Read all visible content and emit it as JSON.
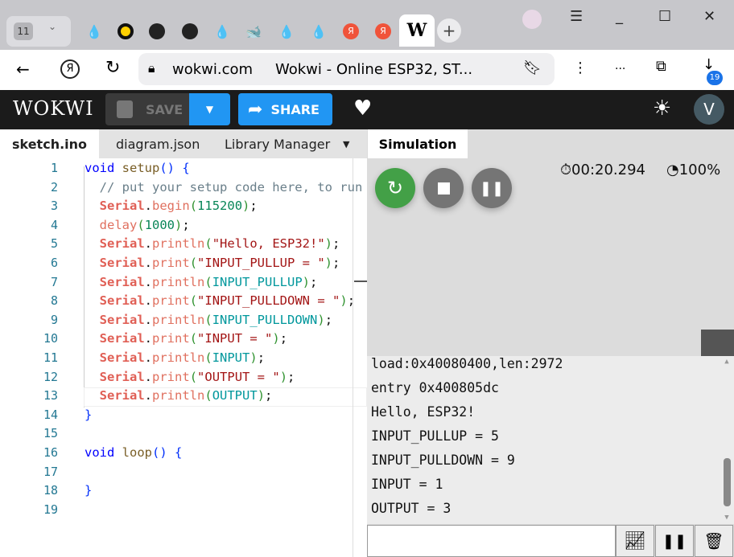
{
  "browser": {
    "tab_count": "11",
    "url": "wokwi.com",
    "page_title": "Wokwi - Online ESP32, ST...",
    "downloads_badge": "19",
    "menu_ellipsis": "..."
  },
  "toolbar": {
    "logo": "WOKWI",
    "save_label": "SAVE",
    "share_label": "SHARE",
    "avatar_letter": "V",
    "accent": "#2196f3"
  },
  "editor_tabs": [
    {
      "label": "sketch.ino",
      "active": true
    },
    {
      "label": "diagram.json"
    },
    {
      "label": "Library Manager"
    }
  ],
  "simulation": {
    "tab_label": "Simulation",
    "timer": "00:20.294",
    "speed": "100%"
  },
  "code": [
    [
      [
        "kw",
        "void"
      ],
      [
        "pu",
        " "
      ],
      [
        "fn",
        "setup"
      ],
      [
        "pb",
        "() {"
      ]
    ],
    [
      [
        "cm",
        "  // put your setup code here, to run once:"
      ]
    ],
    [
      [
        "pu",
        "  "
      ],
      [
        "cls",
        "Serial"
      ],
      [
        "pu",
        "."
      ],
      [
        "m",
        "begin"
      ],
      [
        "pg",
        "("
      ],
      [
        "num",
        "115200"
      ],
      [
        "pg",
        ")"
      ],
      [
        "pu",
        ";"
      ]
    ],
    [
      [
        "pu",
        "  "
      ],
      [
        "m",
        "delay"
      ],
      [
        "pg",
        "("
      ],
      [
        "num",
        "1000"
      ],
      [
        "pg",
        ")"
      ],
      [
        "pu",
        ";"
      ]
    ],
    [
      [
        "pu",
        "  "
      ],
      [
        "cls",
        "Serial"
      ],
      [
        "pu",
        "."
      ],
      [
        "m",
        "println"
      ],
      [
        "pg",
        "("
      ],
      [
        "str",
        "\"Hello, ESP32!\""
      ],
      [
        "pg",
        ")"
      ],
      [
        "pu",
        ";"
      ]
    ],
    [
      [
        "pu",
        "  "
      ],
      [
        "cls",
        "Serial"
      ],
      [
        "pu",
        "."
      ],
      [
        "m",
        "print"
      ],
      [
        "pg",
        "("
      ],
      [
        "str",
        "\"INPUT_PULLUP = \""
      ],
      [
        "pg",
        ")"
      ],
      [
        "pu",
        ";"
      ]
    ],
    [
      [
        "pu",
        "  "
      ],
      [
        "cls",
        "Serial"
      ],
      [
        "pu",
        "."
      ],
      [
        "m",
        "println"
      ],
      [
        "pg",
        "("
      ],
      [
        "cst",
        "INPUT_PULLUP"
      ],
      [
        "pg",
        ")"
      ],
      [
        "pu",
        ";"
      ]
    ],
    [
      [
        "pu",
        "  "
      ],
      [
        "cls",
        "Serial"
      ],
      [
        "pu",
        "."
      ],
      [
        "m",
        "print"
      ],
      [
        "pg",
        "("
      ],
      [
        "str",
        "\"INPUT_PULLDOWN = \""
      ],
      [
        "pg",
        ")"
      ],
      [
        "pu",
        ";"
      ]
    ],
    [
      [
        "pu",
        "  "
      ],
      [
        "cls",
        "Serial"
      ],
      [
        "pu",
        "."
      ],
      [
        "m",
        "println"
      ],
      [
        "pg",
        "("
      ],
      [
        "cst",
        "INPUT_PULLDOWN"
      ],
      [
        "pg",
        ")"
      ],
      [
        "pu",
        ";"
      ]
    ],
    [
      [
        "pu",
        "  "
      ],
      [
        "cls",
        "Serial"
      ],
      [
        "pu",
        "."
      ],
      [
        "m",
        "print"
      ],
      [
        "pg",
        "("
      ],
      [
        "str",
        "\"INPUT = \""
      ],
      [
        "pg",
        ")"
      ],
      [
        "pu",
        ";"
      ]
    ],
    [
      [
        "pu",
        "  "
      ],
      [
        "cls",
        "Serial"
      ],
      [
        "pu",
        "."
      ],
      [
        "m",
        "println"
      ],
      [
        "pg",
        "("
      ],
      [
        "cst",
        "INPUT"
      ],
      [
        "pg",
        ")"
      ],
      [
        "pu",
        ";"
      ]
    ],
    [
      [
        "pu",
        "  "
      ],
      [
        "cls",
        "Serial"
      ],
      [
        "pu",
        "."
      ],
      [
        "m",
        "print"
      ],
      [
        "pg",
        "("
      ],
      [
        "str",
        "\"OUTPUT = \""
      ],
      [
        "pg",
        ")"
      ],
      [
        "pu",
        ";"
      ]
    ],
    [
      [
        "pu",
        "  "
      ],
      [
        "cls",
        "Serial"
      ],
      [
        "pu",
        "."
      ],
      [
        "m",
        "println"
      ],
      [
        "pg",
        "("
      ],
      [
        "cst",
        "OUTPUT"
      ],
      [
        "pg",
        ")"
      ],
      [
        "pu",
        ";"
      ]
    ],
    [
      [
        "pb",
        "}"
      ]
    ],
    [],
    [
      [
        "kw",
        "void"
      ],
      [
        "pu",
        " "
      ],
      [
        "fn",
        "loop"
      ],
      [
        "pb",
        "() {"
      ]
    ],
    [],
    [
      [
        "pb",
        "}"
      ]
    ],
    []
  ],
  "console": [
    "load:0x40080400,len:2972",
    "entry 0x400805dc",
    "Hello, ESP32!",
    "INPUT_PULLUP = 5",
    "INPUT_PULLDOWN = 9",
    "INPUT = 1",
    "OUTPUT = 3"
  ]
}
